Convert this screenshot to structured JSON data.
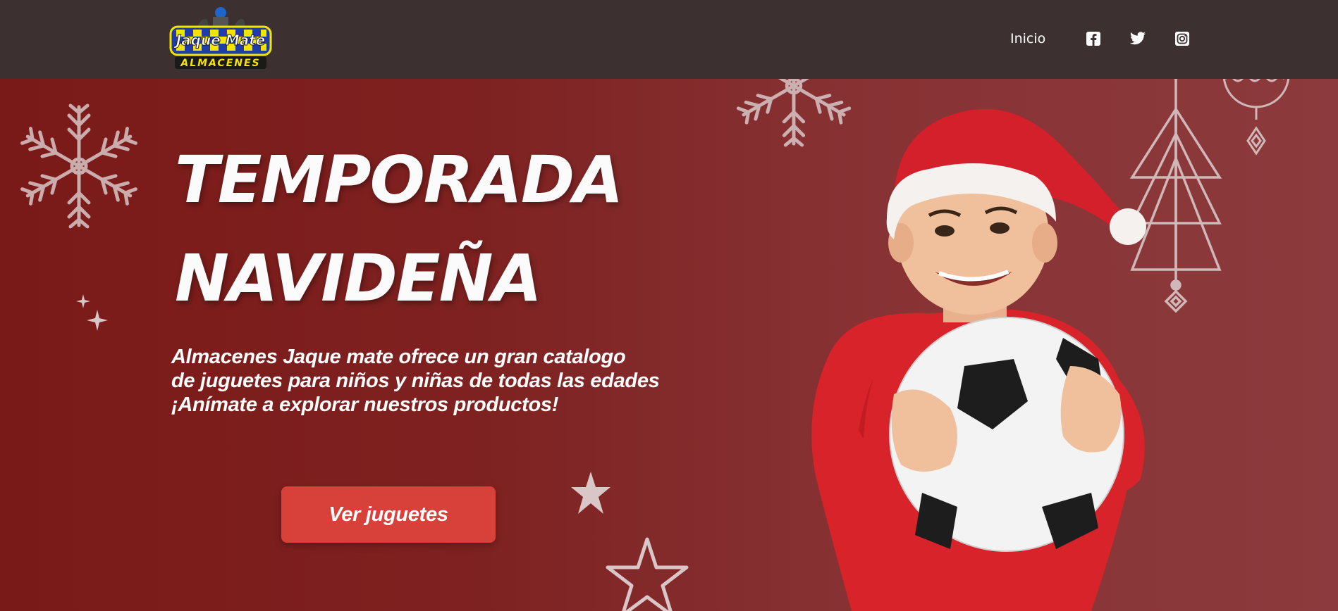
{
  "header": {
    "logo": {
      "line1": "Jaque Mate",
      "line2": "ALMACENES"
    },
    "nav": {
      "home_label": "Inicio"
    },
    "social": [
      "facebook-icon",
      "twitter-icon",
      "instagram-icon"
    ]
  },
  "hero": {
    "title_line1": "TEMPORADA",
    "title_line2": "NAVIDEÑA",
    "description_lines": [
      "Almacenes Jaque mate ofrece un gran catalogo",
      "de juguetes para niños y niñas de todas las edades",
      "¡Anímate a explorar nuestros productos!"
    ],
    "cta_label": "Ver juguetes"
  },
  "colors": {
    "header_bg": "#3d3031",
    "hero_bg": "#7e2120",
    "button": "#d8413a",
    "text": "#ffffff"
  }
}
